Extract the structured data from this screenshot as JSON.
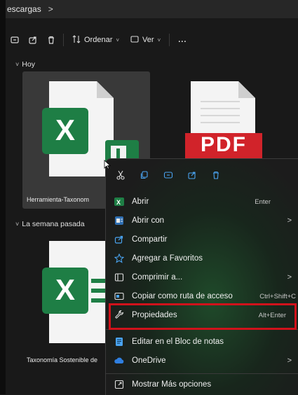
{
  "breadcrumb": {
    "current": "escargas",
    "separator": ">"
  },
  "toolbar": {
    "sort_label": "Ordenar",
    "view_label": "Ver",
    "more_label": "..."
  },
  "sections": {
    "today": "Hoy",
    "last_week": "La semana pasada"
  },
  "files": {
    "excel_tool": "Herramienta-Taxonom",
    "pdf_file_badge": "PDF",
    "excel_taxonomy": "Taxonomía Sostenible de"
  },
  "context_menu": {
    "items": [
      {
        "label": "Abrir",
        "shortcut": "Enter",
        "icon": "excel-icon"
      },
      {
        "label": "Abrir con",
        "submenu": ">",
        "icon": "open-with-icon"
      },
      {
        "label": "Compartir",
        "icon": "share-icon"
      },
      {
        "label": "Agregar a Favoritos",
        "icon": "star-icon"
      },
      {
        "label": "Comprimir a...",
        "submenu": ">",
        "icon": "zip-icon"
      },
      {
        "label": "Copiar como ruta de acceso",
        "shortcut": "Ctrl+Shift+C",
        "icon": "copy-path-icon"
      },
      {
        "label": "Propiedades",
        "shortcut": "Alt+Enter",
        "icon": "wrench-icon"
      },
      {
        "label": "Editar en el Bloc de notas",
        "icon": "notepad-icon"
      },
      {
        "label": "OneDrive",
        "submenu": ">",
        "icon": "cloud-icon"
      },
      {
        "label": "Mostrar Más opciones",
        "icon": "more-options-icon"
      }
    ]
  },
  "colors": {
    "excel_green": "#1e7e45",
    "pdf_red": "#d1232a",
    "highlight_red": "#d0121b",
    "accent_blue": "#4aa3f0"
  }
}
